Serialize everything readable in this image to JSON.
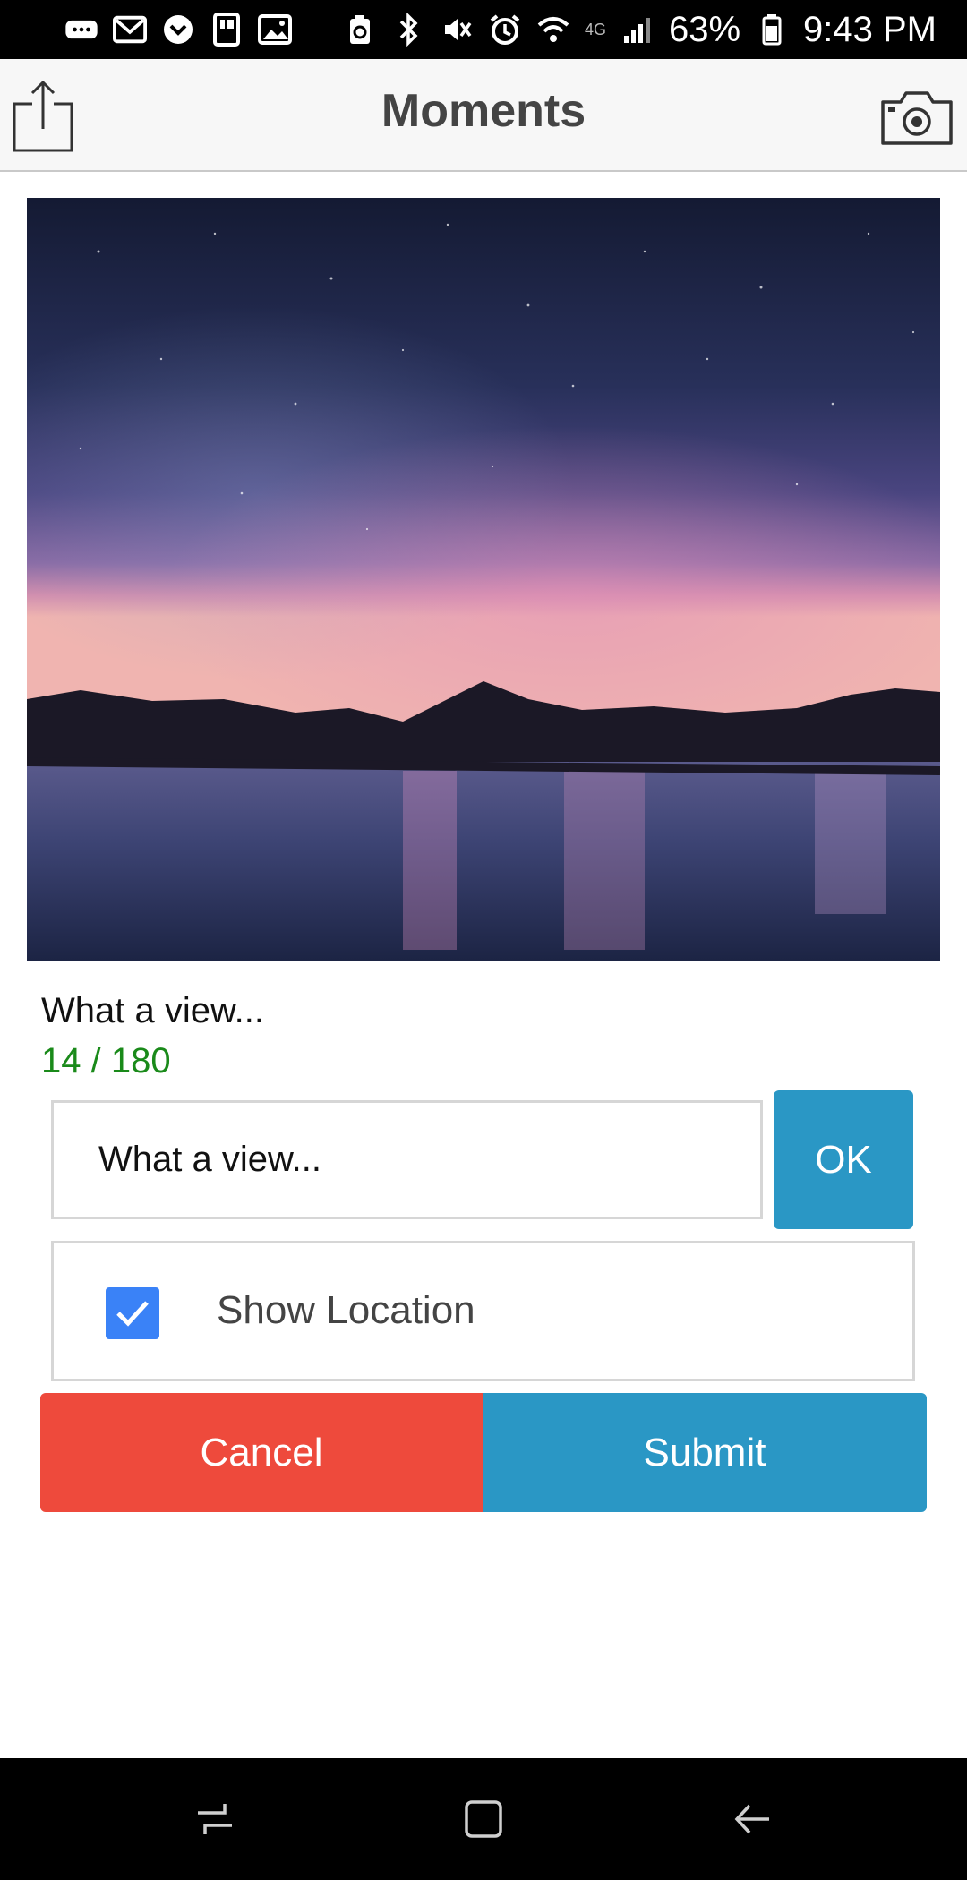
{
  "status_bar": {
    "network_label": "4G",
    "battery": "63%",
    "time": "9:43 PM",
    "icons": [
      "messages-icon",
      "gmail-icon",
      "pocket-icon",
      "id-card-icon",
      "gallery-icon",
      "recycle-icon",
      "bluetooth-icon",
      "mute-icon",
      "alarm-icon",
      "wifi-icon",
      "signal-icon",
      "battery-icon"
    ]
  },
  "header": {
    "title": "Moments",
    "left_icon": "share-icon",
    "right_icon": "camera-icon"
  },
  "photo": {
    "subject": "starry night sky over lake"
  },
  "caption": {
    "text": "What a view...",
    "counter": "14 / 180",
    "counter_color": "#1a8a1a"
  },
  "input": {
    "value": "What a view...",
    "ok_label": "OK"
  },
  "location": {
    "label": "Show Location",
    "checked": true
  },
  "actions": {
    "cancel_label": "Cancel",
    "submit_label": "Submit",
    "cancel_color": "#ee4a3c",
    "submit_color": "#2a97c5"
  },
  "nav_bar": {
    "icons": [
      "recent-apps-icon",
      "home-icon",
      "back-icon"
    ]
  }
}
